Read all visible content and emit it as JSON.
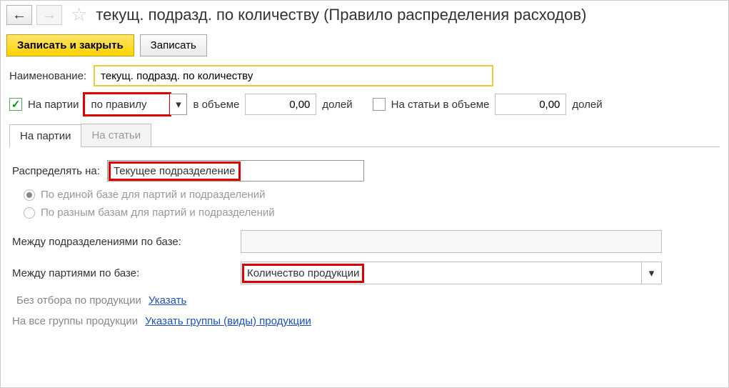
{
  "title": "текущ. подразд. по количеству (Правило распределения расходов)",
  "toolbar": {
    "save_close": "Записать и закрыть",
    "save": "Записать"
  },
  "form": {
    "name_label": "Наименование:",
    "name_value": "текущ. подразд. по количеству",
    "on_batches_label": "На партии",
    "rule_value": "по правилу",
    "volume_label": "в объеме",
    "volume_value": "0,00",
    "shares_label": "долей",
    "on_items_label": "На статьи в объеме",
    "items_volume_value": "0,00",
    "items_shares_label": "долей"
  },
  "tabs": {
    "batches": "На партии",
    "items": "На статьи"
  },
  "tab_content": {
    "distribute_to_label": "Распределять на:",
    "distribute_to_value": "Текущее подразделение",
    "radio1": "По единой базе для партий и подразделений",
    "radio2": "По разным базам для партий и подразделений",
    "between_depts_label": "Между подразделениями по базе:",
    "between_batches_label": "Между партиями по базе:",
    "between_batches_value": "Количество продукции",
    "no_filter_label": "Без отбора по продукции",
    "specify_link": "Указать",
    "all_groups_label": "На все группы продукции",
    "specify_groups_link": "Указать группы (виды) продукции"
  }
}
